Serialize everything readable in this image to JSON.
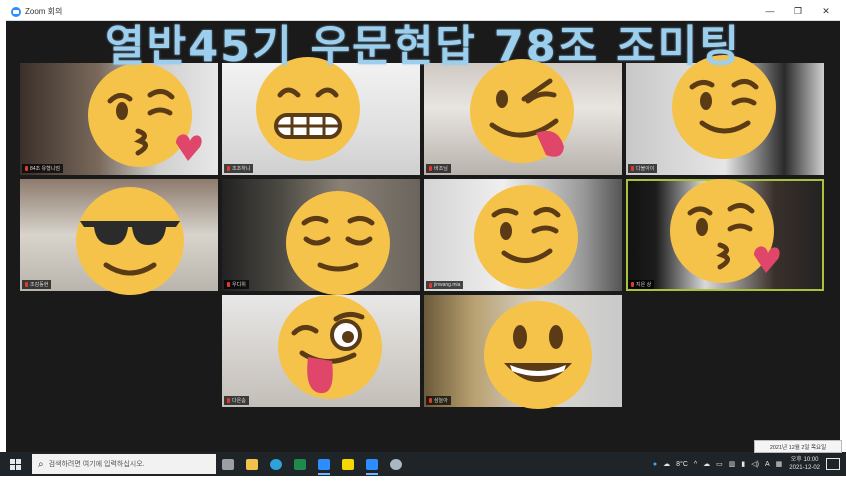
{
  "window": {
    "title": "Zoom 회의",
    "controls": [
      "—",
      "❐",
      "✕"
    ]
  },
  "banner": "열반45기 우문현답 78조 조미팅",
  "participants": [
    {
      "name": "84조 유형니엄",
      "emoji": "kissing-heart",
      "active": false
    },
    {
      "name": "조조하니",
      "emoji": "grimacing",
      "active": false
    },
    {
      "name": "바조님",
      "emoji": "tongue-wink",
      "active": false
    },
    {
      "name": "다볼아이",
      "emoji": "wink",
      "active": false
    },
    {
      "name": "조감동현",
      "emoji": "sunglasses",
      "active": false
    },
    {
      "name": "우디위",
      "emoji": "relieved",
      "active": false
    },
    {
      "name": "jinwang.mia",
      "emoji": "wink",
      "active": false
    },
    {
      "name": "지은 상",
      "emoji": "kissing-heart",
      "active": true
    },
    {
      "name": "다온솜",
      "emoji": "tongue-wink-eye",
      "active": false
    },
    {
      "name": "삼늘아",
      "emoji": "smiley",
      "active": false
    }
  ],
  "taskbar": {
    "search_placeholder": "검색하려면 여기에 입력하십시오.",
    "weather": "8°C",
    "ime": "A",
    "time": "오후 10:00",
    "date": "2021-12-02",
    "date_popup": "2021년 12월 2일 목요일",
    "apps": [
      {
        "icon": "task-view-icon",
        "color": "#9aa0a6"
      },
      {
        "icon": "file-explorer-icon",
        "color": "#f2c24b"
      },
      {
        "icon": "edge-icon",
        "color": "#2fa3d9"
      },
      {
        "icon": "excel-icon",
        "color": "#1e8a4c"
      },
      {
        "icon": "zoom-icon",
        "color": "#2d8cff"
      },
      {
        "icon": "kakaotalk-icon",
        "color": "#f5d800"
      },
      {
        "icon": "zoom-meeting-icon",
        "color": "#2d8cff"
      },
      {
        "icon": "browser-icon",
        "color": "#aab6c2"
      }
    ]
  }
}
